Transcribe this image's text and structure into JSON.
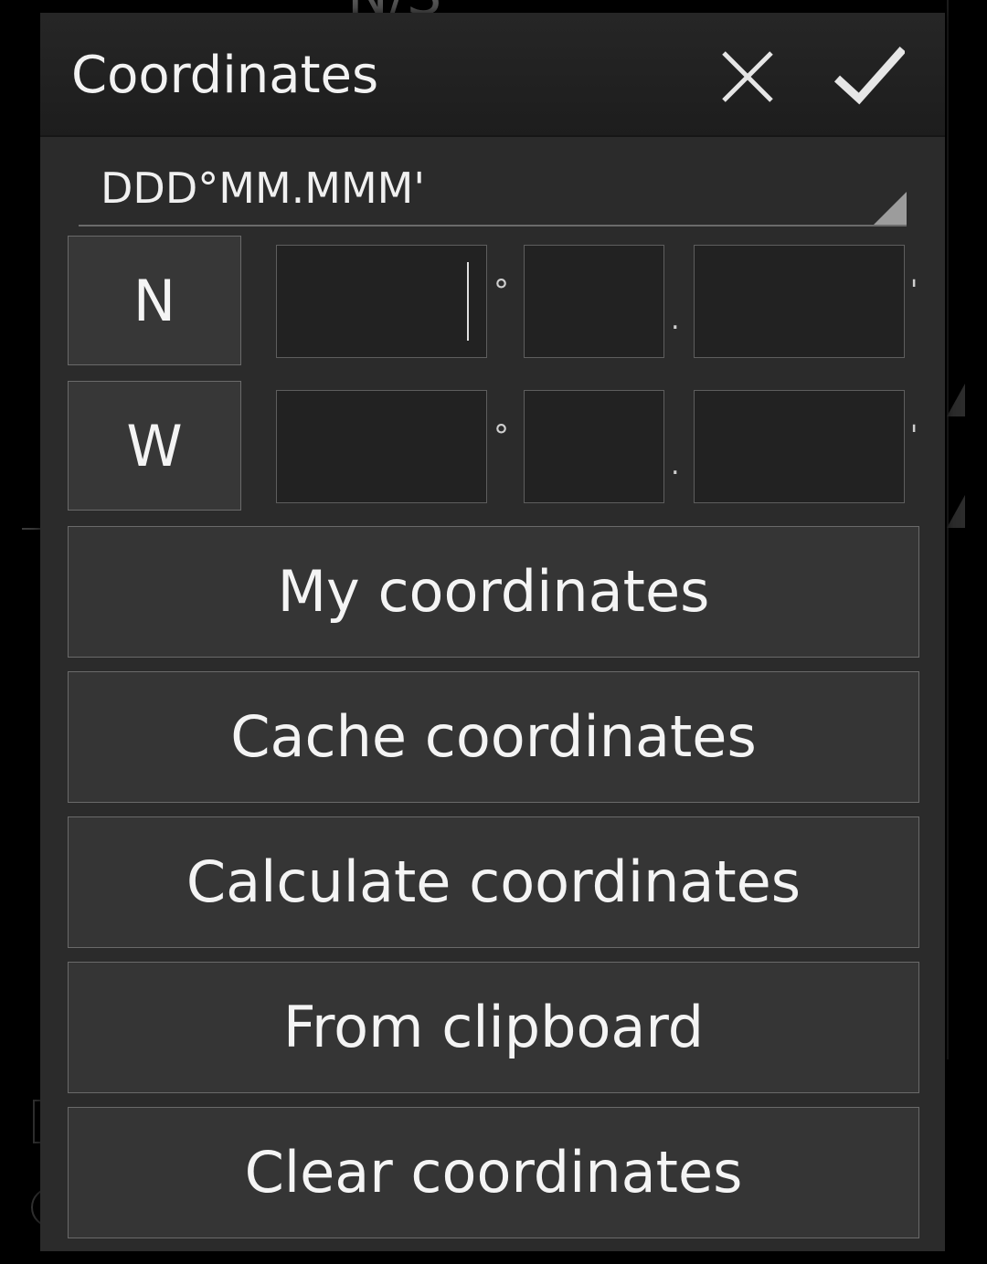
{
  "background": {
    "partial_text": "N/S"
  },
  "dialog": {
    "title": "Coordinates",
    "cancel_icon": "close-icon",
    "confirm_icon": "checkmark-icon"
  },
  "format": {
    "selected": "DDD°MM.MMM'"
  },
  "latitude": {
    "hemisphere": "N",
    "degrees": "",
    "minutes": "",
    "minute_decimals": "",
    "degree_symbol": "°",
    "decimal_point": ".",
    "minute_symbol": "'"
  },
  "longitude": {
    "hemisphere": "W",
    "degrees": "",
    "minutes": "",
    "minute_decimals": "",
    "degree_symbol": "°",
    "decimal_point": ".",
    "minute_symbol": "'"
  },
  "actions": {
    "my_coordinates": "My coordinates",
    "cache_coordinates": "Cache coordinates",
    "calculate_coordinates": "Calculate coordinates",
    "from_clipboard": "From clipboard",
    "clear_coordinates": "Clear coordinates"
  },
  "colors": {
    "dialog_background": "#2b2b2b",
    "button_background": "#353535",
    "field_background": "#222222",
    "text": "#f4f4f4"
  }
}
